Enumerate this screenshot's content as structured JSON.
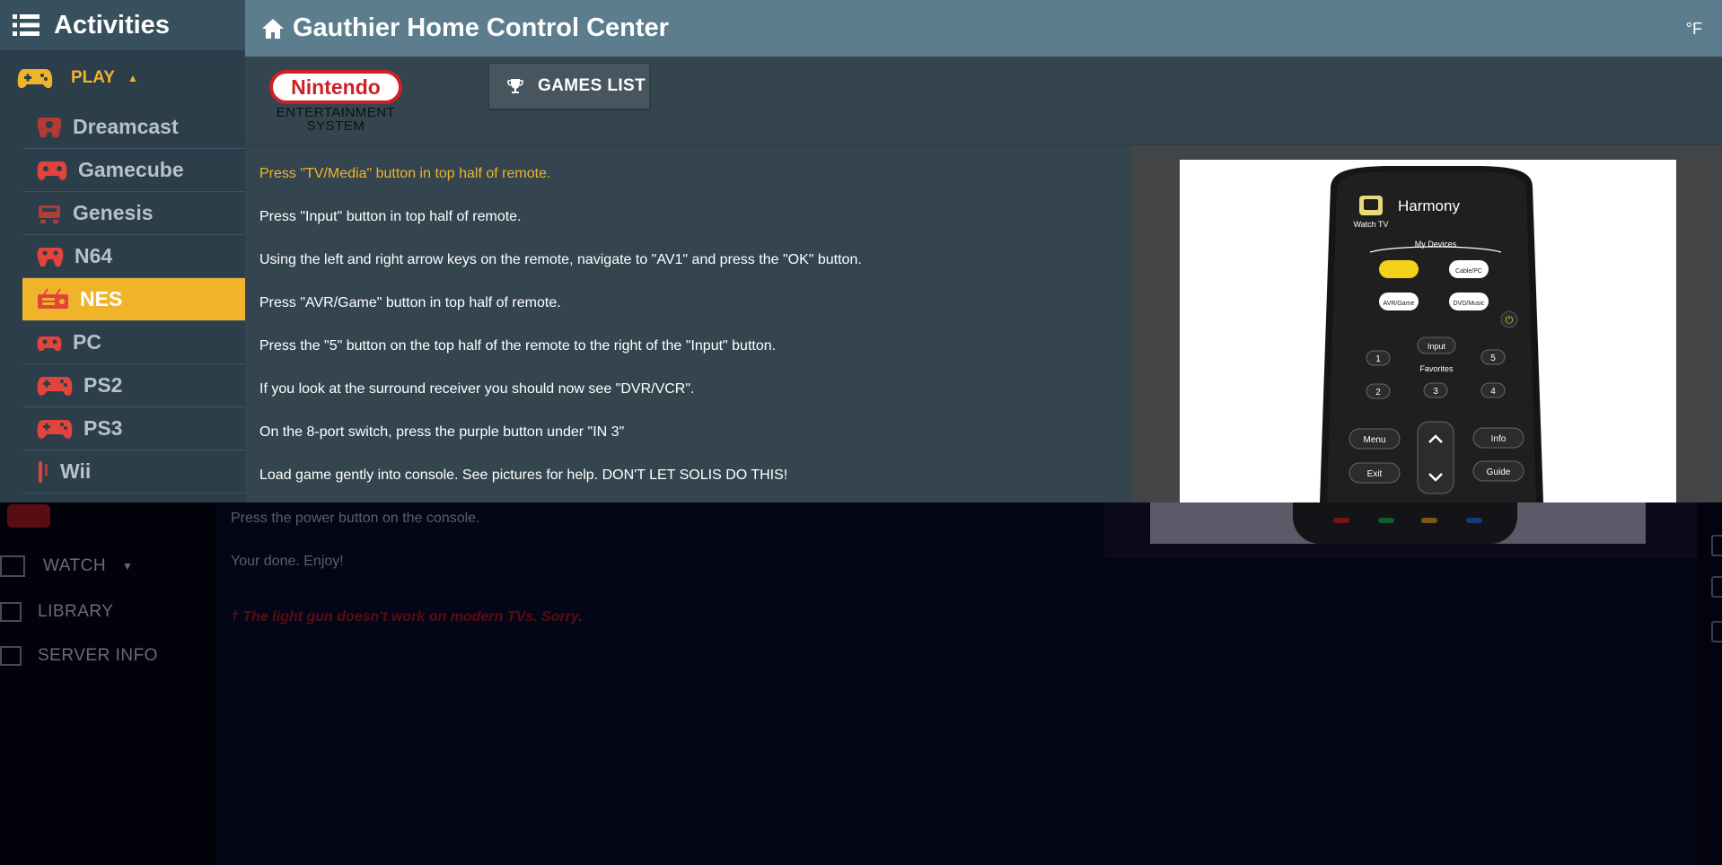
{
  "sidebar": {
    "title": "Activities",
    "section": "PLAY",
    "consoles": [
      {
        "label": "Dreamcast",
        "icon": "dreamcast-controller-icon",
        "active": false
      },
      {
        "label": "Gamecube",
        "icon": "gamecube-controller-icon",
        "active": false
      },
      {
        "label": "Genesis",
        "icon": "genesis-console-icon",
        "active": false
      },
      {
        "label": "N64",
        "icon": "n64-controller-icon",
        "active": false
      },
      {
        "label": "NES",
        "icon": "nes-console-icon",
        "active": true
      },
      {
        "label": "PC",
        "icon": "pc-gamepad-icon",
        "active": false
      },
      {
        "label": "PS2",
        "icon": "ps2-controller-icon",
        "active": false
      },
      {
        "label": "PS3",
        "icon": "ps3-controller-icon",
        "active": false
      },
      {
        "label": "Wii",
        "icon": "wii-remote-icon",
        "active": false
      }
    ]
  },
  "header": {
    "title": "Gauthier Home Control Center",
    "temp_unit": "°F"
  },
  "toolbar": {
    "logo_brand": "Nintendo",
    "logo_line1": "ENTERTAINMENT",
    "logo_line2": "SYSTEM",
    "games_button": "GAMES LIST"
  },
  "instructions": {
    "current_index": 0,
    "steps": [
      "Press \"TV/Media\" button in top half of remote.",
      "Press \"Input\" button in top half of remote.",
      "Using the left and right arrow keys on the remote, navigate to \"AV1\" and press the \"OK\" button.",
      "Press \"AVR/Game\" button in top half of remote.",
      "Press the \"5\" button on the top half of the remote to the right of the \"Input\" button.",
      "If you look at the surround receiver you should now see \"DVR/VCR\".",
      "On the 8-port switch, press the purple button under \"IN 3\"",
      "Load game gently into console. See pictures for help. DON'T LET SOLIS DO THIS!"
    ]
  },
  "remote": {
    "brand": "Harmony",
    "watch_tv": "Watch TV",
    "my_devices": "My Devices",
    "cable_pc": "Cable/PC",
    "avr_game": "AVR/Game",
    "dvd_music": "DVD/Music",
    "input": "Input",
    "favorites": "Favorites",
    "menu": "Menu",
    "info": "Info",
    "exit": "Exit",
    "guide": "Guide",
    "num_1": "1",
    "num_2": "2",
    "num_3": "3",
    "num_4": "4",
    "num_5": "5"
  },
  "background": {
    "steps": [
      "Press the power button on the console.",
      "Your done. Enjoy!"
    ],
    "note": "† The light gun doesn't work on modern TVs. Sorry.",
    "nav": [
      "WATCH",
      "LIBRARY",
      "SERVER INFO"
    ]
  },
  "colors": {
    "accent": "#f0b42a",
    "sidebar": "#2c3e4a",
    "header": "#5c7d8d",
    "panel": "#34454f",
    "console_icon": "#e0443c"
  }
}
